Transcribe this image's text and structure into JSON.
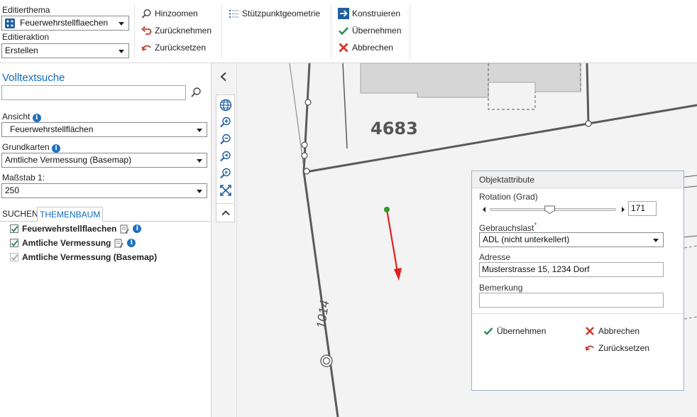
{
  "ribbon": {
    "editing_theme_label": "Editierthema",
    "editing_theme_value": "Feuerwehrstellflaechen",
    "editing_action_label": "Editieraktion",
    "editing_action_value": "Erstellen",
    "zoom_in": "Hinzoomen",
    "undo": "Zurücknehmen",
    "reset": "Zurücksetzen",
    "vertex_geometry": "Stützpunktgeometrie",
    "construct": "Konstruieren",
    "apply": "Übernehmen",
    "cancel": "Abbrechen"
  },
  "left_panel": {
    "search_title": "Volltextsuche",
    "search_value": "",
    "view_label": "Ansicht",
    "view_value": "Feuerwehrstellflächen",
    "basemaps_label": "Grundkarten",
    "basemaps_value": "Amtliche Vermessung (Basemap)",
    "scale_label": "Maßstab 1:",
    "scale_value": "250",
    "tabs": [
      "SUCHEN",
      "THEMENBAUM"
    ],
    "layers": [
      {
        "label": "Feuerwehrstellflaechen",
        "checked": true
      },
      {
        "label": "Amtliche Vermessung",
        "checked": true
      },
      {
        "label": "Amtliche Vermessung (Basemap)",
        "checked": true
      }
    ]
  },
  "map": {
    "parcel_number": "4683",
    "road_label": "1014"
  },
  "dialog": {
    "title": "Objektattribute",
    "rotation_label": "Rotation (Grad)",
    "rotation_value": "171",
    "rotation_max": 360,
    "usage_load_label": "Gebrauchslast",
    "required_mark": "*",
    "usage_load_value": "ADL (nicht unterkellert)",
    "address_label": "Adresse",
    "address_value": "Musterstrasse 15, 1234 Dorf",
    "remark_label": "Bemerkung",
    "remark_value": "",
    "apply": "Übernehmen",
    "cancel": "Abbrechen",
    "reset": "Zurücksetzen"
  },
  "colors": {
    "accent": "#1f6fc1",
    "link": "#0f6cbd",
    "check": "#2e8b57",
    "cancel": "#d0392b",
    "undo": "#c0392b",
    "arrow": "#e41e1e",
    "point": "#2e9a2e"
  }
}
